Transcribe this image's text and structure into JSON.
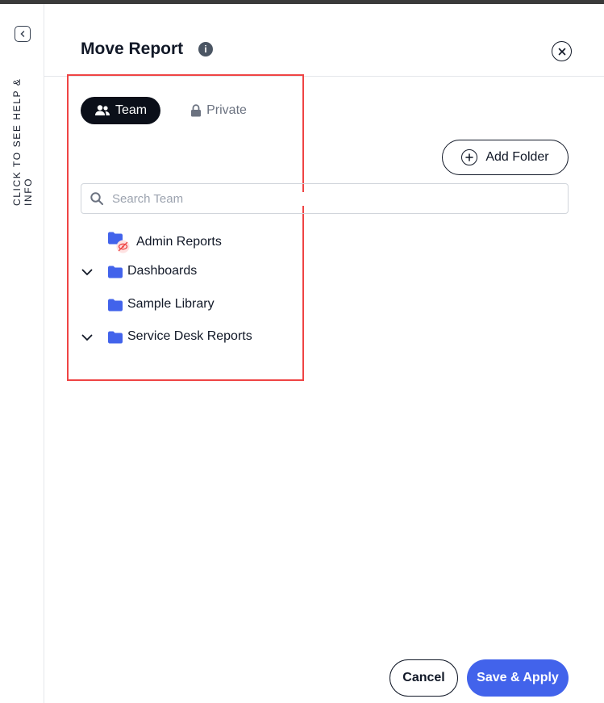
{
  "help_rail": {
    "label": "CLICK TO SEE HELP & INFO",
    "toggle_icon": "collapse-left-icon"
  },
  "dialog": {
    "title": "Move Report",
    "info_icon": "info-icon",
    "close_icon": "close-icon"
  },
  "tabs": [
    {
      "label": "Team",
      "icon": "users-icon",
      "active": true
    },
    {
      "label": "Private",
      "icon": "lock-icon",
      "active": false
    }
  ],
  "add_folder": {
    "label": "Add Folder",
    "icon": "plus-circle-icon"
  },
  "search": {
    "placeholder": "Search Team",
    "value": ""
  },
  "tree": [
    {
      "label": "Admin Reports",
      "expandable": false,
      "hidden_badge": true
    },
    {
      "label": "Dashboards",
      "expandable": true,
      "hidden_badge": false
    },
    {
      "label": "Sample Library",
      "expandable": false,
      "hidden_badge": false
    },
    {
      "label": "Service Desk Reports",
      "expandable": true,
      "hidden_badge": false
    }
  ],
  "footer": {
    "cancel_label": "Cancel",
    "save_label": "Save & Apply"
  },
  "colors": {
    "accent": "#4263eb",
    "folder": "#4263eb",
    "highlight": "#ef4444",
    "hidden_badge": "#ef4444"
  }
}
